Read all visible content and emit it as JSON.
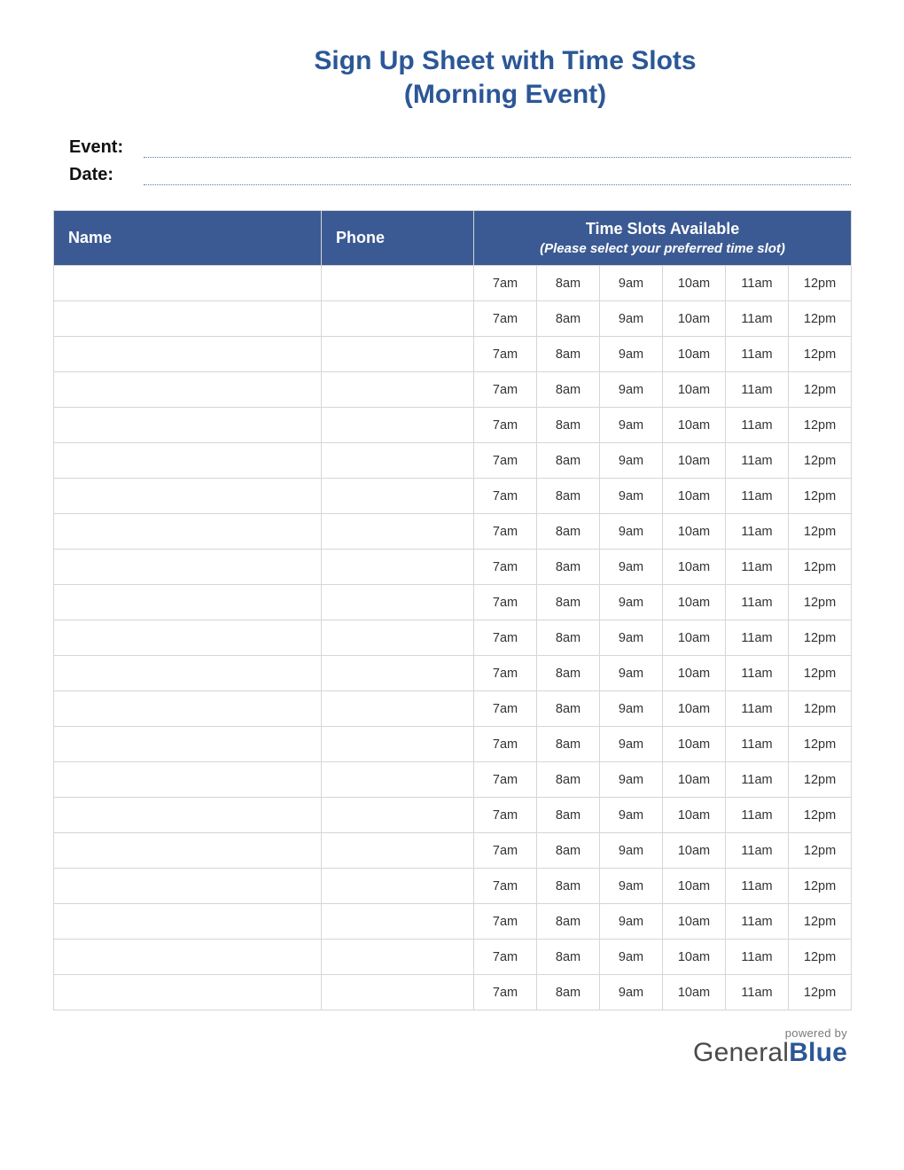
{
  "title_line1": "Sign Up Sheet with Time Slots",
  "title_line2": "(Morning Event)",
  "meta": {
    "event_label": "Event:",
    "event_value": "",
    "date_label": "Date:",
    "date_value": ""
  },
  "table": {
    "headers": {
      "name": "Name",
      "phone": "Phone",
      "timeslots_title": "Time Slots Available",
      "timeslots_subtitle": "(Please select your preferred time slot)"
    },
    "slots": [
      "7am",
      "8am",
      "9am",
      "10am",
      "11am",
      "12pm"
    ],
    "row_count": 21
  },
  "footer": {
    "powered": "powered by",
    "brand_first": "General",
    "brand_second": "Blue"
  },
  "colors": {
    "accent": "#2b5797",
    "header_bg": "#3b5a93",
    "border": "#d6d6d6"
  }
}
